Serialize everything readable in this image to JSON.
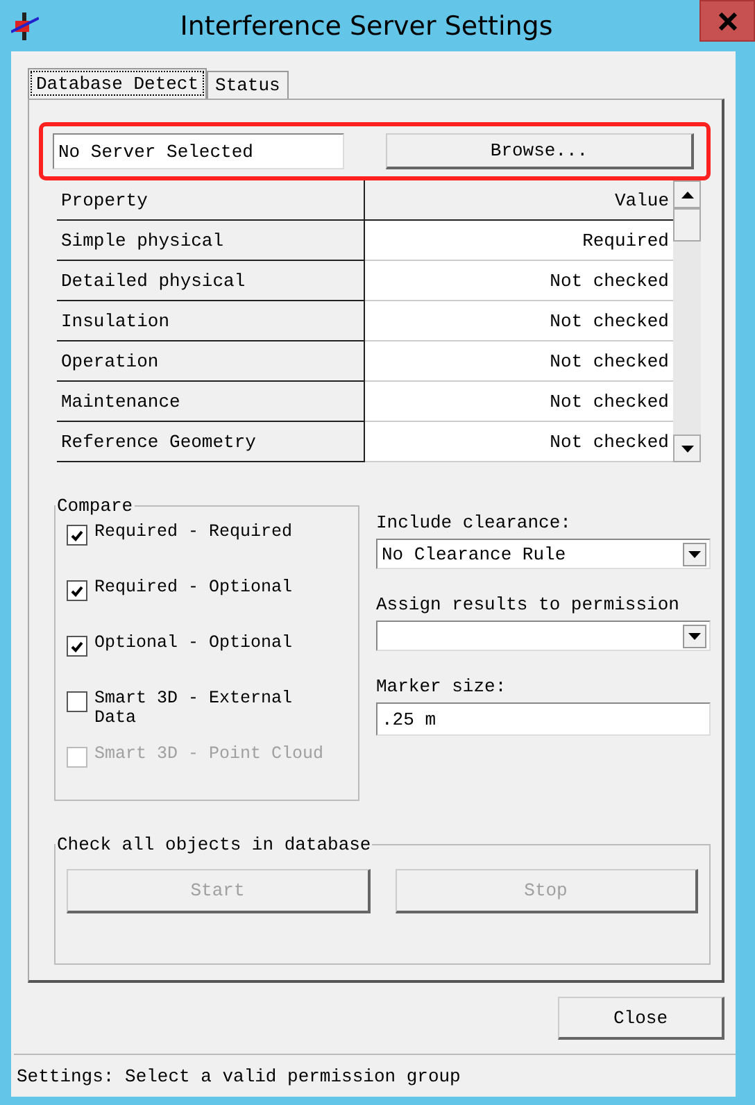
{
  "window": {
    "title": "Interference Server Settings"
  },
  "tabs": [
    {
      "label": "Database Detect",
      "selected": true
    },
    {
      "label": "Status",
      "selected": false
    }
  ],
  "server": {
    "value": "No Server Selected",
    "browse_button": "Browse...",
    "highlighted": true
  },
  "table": {
    "columns": [
      "Property",
      "Value"
    ],
    "rows": [
      {
        "property": "Simple physical",
        "value": "Required"
      },
      {
        "property": "Detailed physical",
        "value": "Not checked"
      },
      {
        "property": "Insulation",
        "value": "Not checked"
      },
      {
        "property": "Operation",
        "value": "Not checked"
      },
      {
        "property": "Maintenance",
        "value": "Not checked"
      },
      {
        "property": "Reference Geometry",
        "value": "Not checked"
      }
    ]
  },
  "compare": {
    "title": "Compare",
    "options": [
      {
        "label": "Required - Required",
        "checked": true,
        "disabled": false
      },
      {
        "label": "Required - Optional",
        "checked": true,
        "disabled": false
      },
      {
        "label": "Optional - Optional",
        "checked": true,
        "disabled": false
      },
      {
        "label": "Smart 3D - External Data",
        "checked": false,
        "disabled": false
      },
      {
        "label": "Smart 3D - Point Cloud",
        "checked": false,
        "disabled": true
      }
    ]
  },
  "include_clearance": {
    "label": "Include clearance:",
    "value": "No Clearance Rule"
  },
  "assign_permission": {
    "label": "Assign results to permission"
  },
  "marker_size": {
    "label": "Marker size:",
    "value": ".25 m"
  },
  "check_all": {
    "title": "Check all objects in database",
    "buttons": [
      {
        "label": "Start",
        "disabled": true
      },
      {
        "label": "Stop",
        "disabled": true
      }
    ]
  },
  "close_button": "Close",
  "status_bar": "Settings: Select a valid permission group"
}
